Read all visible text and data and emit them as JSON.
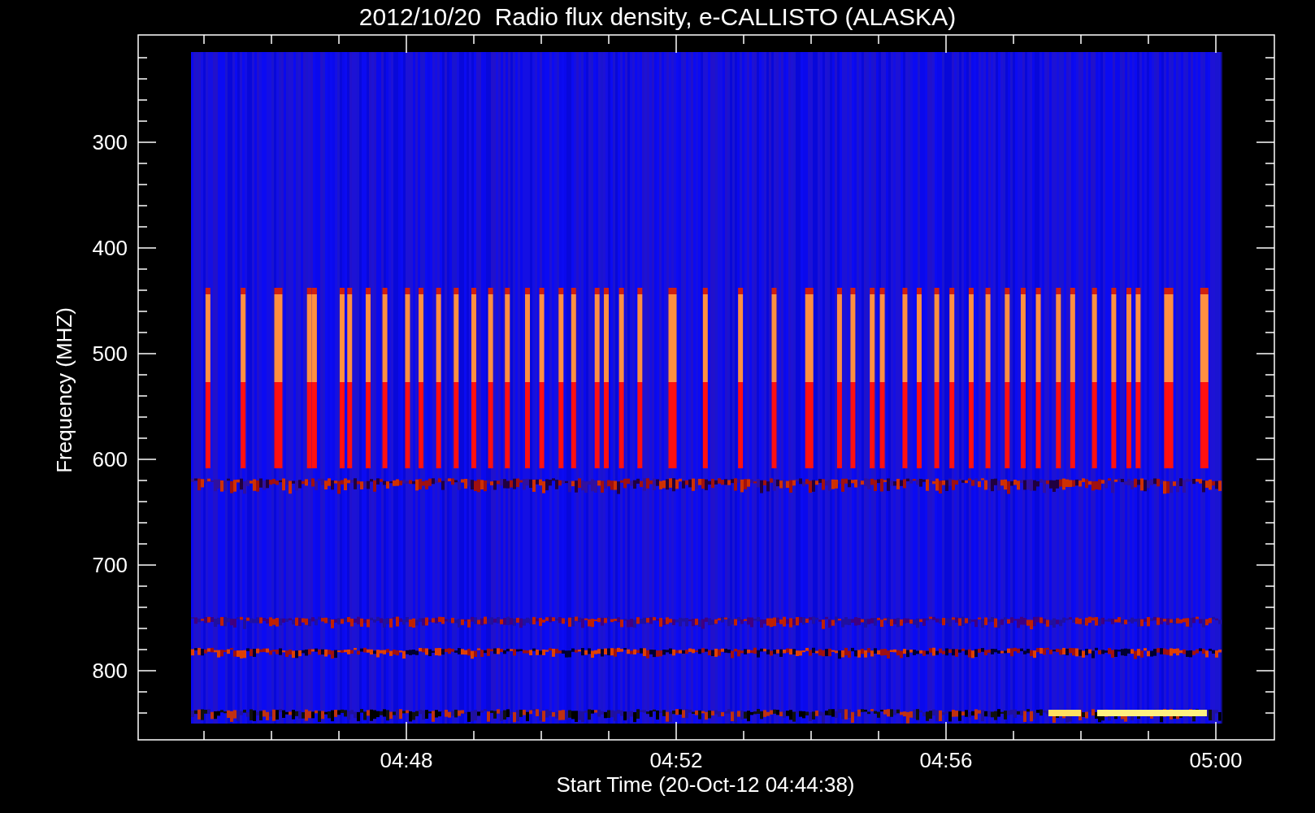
{
  "chart": {
    "title": "2012/10/20  Radio flux density, e-CALLISTO (ALASKA)",
    "ylabel": "Frequency (MHZ)",
    "xlabel": "Start Time (20-Oct-12 04:44:38)",
    "yticks": [
      "300",
      "400",
      "500",
      "600",
      "700",
      "800"
    ],
    "xticks": [
      "04:48",
      "04:52",
      "04:56",
      "05:00"
    ]
  }
}
